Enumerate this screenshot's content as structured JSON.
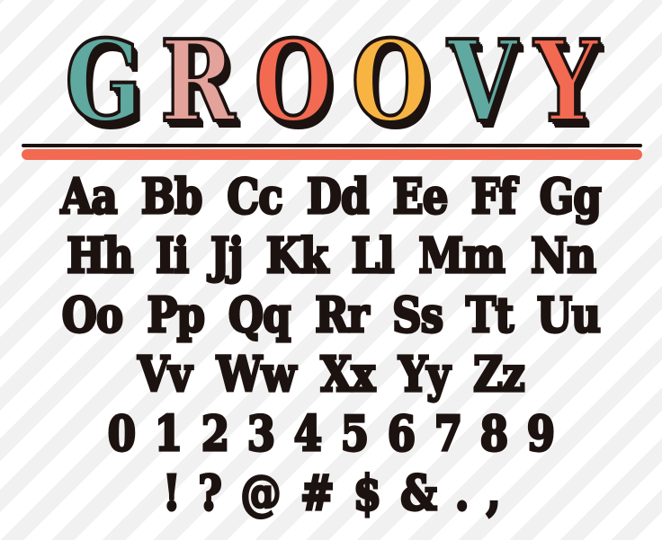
{
  "title": {
    "letters": [
      {
        "char": "G",
        "color": "#5fa9a0"
      },
      {
        "char": "R",
        "color": "#e3a29a"
      },
      {
        "char": "O",
        "color": "#f26a52"
      },
      {
        "char": "O",
        "color": "#f7b443"
      },
      {
        "char": "V",
        "color": "#5fa9a0"
      },
      {
        "char": "Y",
        "color": "#f26a52"
      }
    ]
  },
  "rule": {
    "dark_color": "#1c1210",
    "accent_color": "#f26a52"
  },
  "rows": [
    {
      "name": "row-a-g",
      "items": [
        "Aa",
        "Bb",
        "Cc",
        "Dd",
        "Ee",
        "Ff",
        "Gg"
      ]
    },
    {
      "name": "row-h-n",
      "items": [
        "Hh",
        "Ii",
        "Jj",
        "Kk",
        "Ll",
        "Mm",
        "Nn"
      ]
    },
    {
      "name": "row-o-u",
      "items": [
        "Oo",
        "Pp",
        "Qq",
        "Rr",
        "Ss",
        "Tt",
        "Uu"
      ]
    },
    {
      "name": "row-v-z",
      "items": [
        "Vv",
        "Ww",
        "Xx",
        "Yy",
        "Zz"
      ]
    },
    {
      "name": "row-numbers",
      "items": [
        "0",
        "1",
        "2",
        "3",
        "4",
        "5",
        "6",
        "7",
        "8",
        "9"
      ]
    },
    {
      "name": "row-symbols",
      "items": [
        "!",
        "?",
        "@",
        "#",
        "$",
        "&",
        ".",
        ","
      ]
    }
  ],
  "colors": {
    "glyph": "#1c1210",
    "background": "#ffffff",
    "stripe": "#f1f1f1"
  }
}
